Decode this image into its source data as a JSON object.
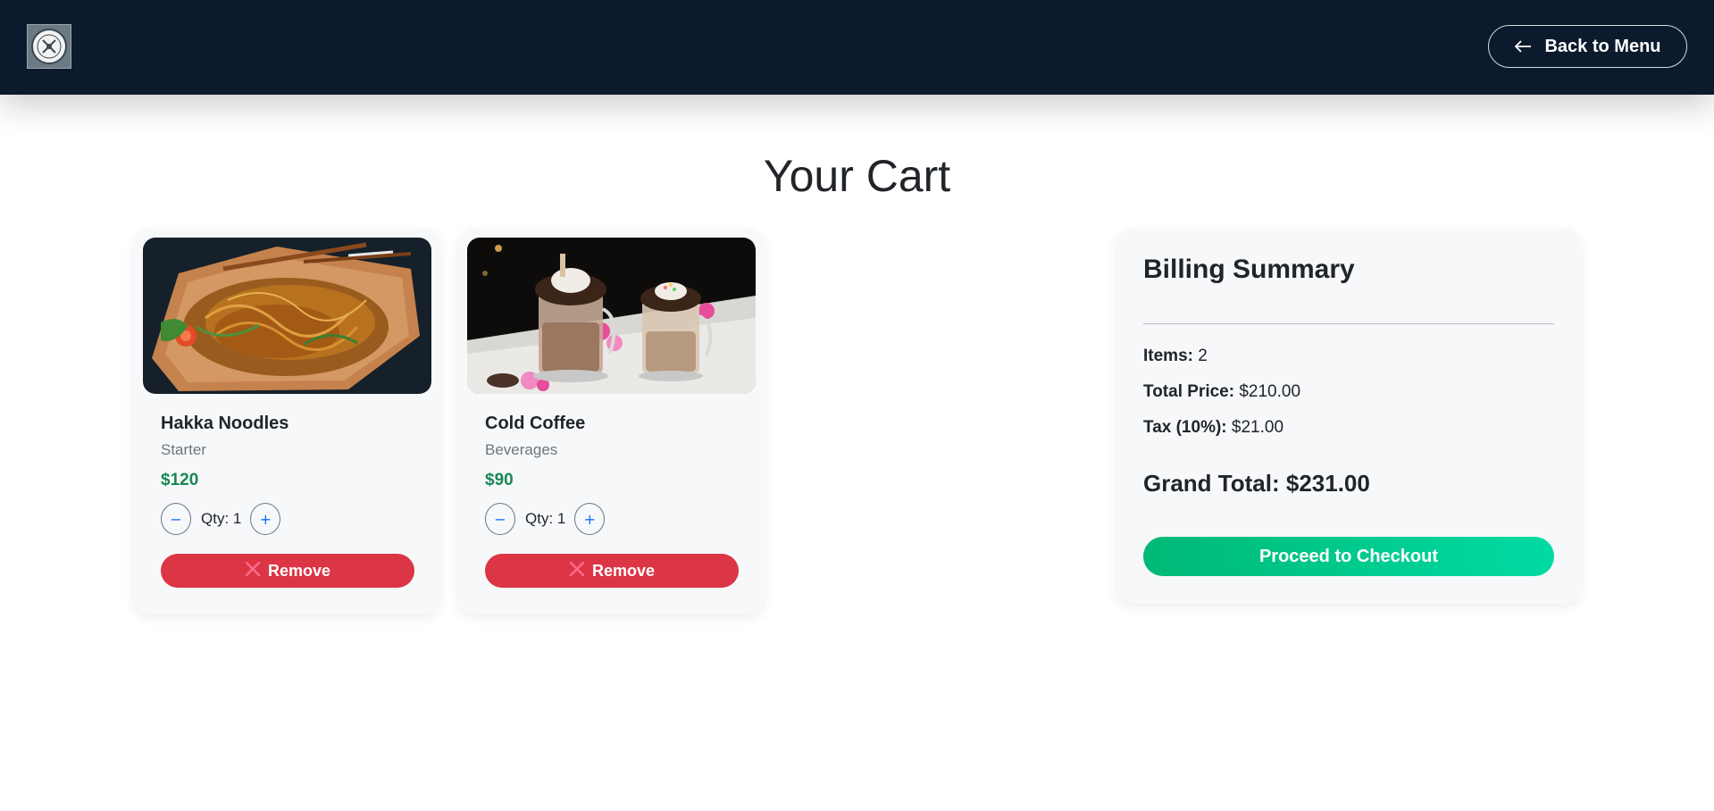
{
  "nav": {
    "logo_text": "",
    "back_label": "Back to Menu"
  },
  "page": {
    "title": "Your Cart"
  },
  "cart": {
    "items": [
      {
        "name": "Hakka Noodles",
        "category": "Starter",
        "price": "$120",
        "qty_label": "Qty: 1",
        "remove_label": "Remove",
        "minus": "−",
        "plus": "+"
      },
      {
        "name": "Cold Coffee",
        "category": "Beverages",
        "price": "$90",
        "qty_label": "Qty: 1",
        "remove_label": "Remove",
        "minus": "−",
        "plus": "+"
      }
    ]
  },
  "billing": {
    "title": "Billing Summary",
    "items_label": "Items:",
    "items_value": "2",
    "total_label": "Total Price:",
    "total_value": "$210.00",
    "tax_label": "Tax (10%):",
    "tax_value": "$21.00",
    "grand_label": "Grand Total:",
    "grand_value": "$231.00",
    "checkout_label": "Proceed to Checkout"
  },
  "icons": {
    "back": "arrow-left-icon",
    "remove": "close-icon",
    "logo": "restaurant-logo"
  },
  "colors": {
    "navbar": "#0b1a2c",
    "price": "#198754",
    "remove": "#dc3545",
    "checkout_start": "#00b876",
    "checkout_end": "#00dba3"
  }
}
